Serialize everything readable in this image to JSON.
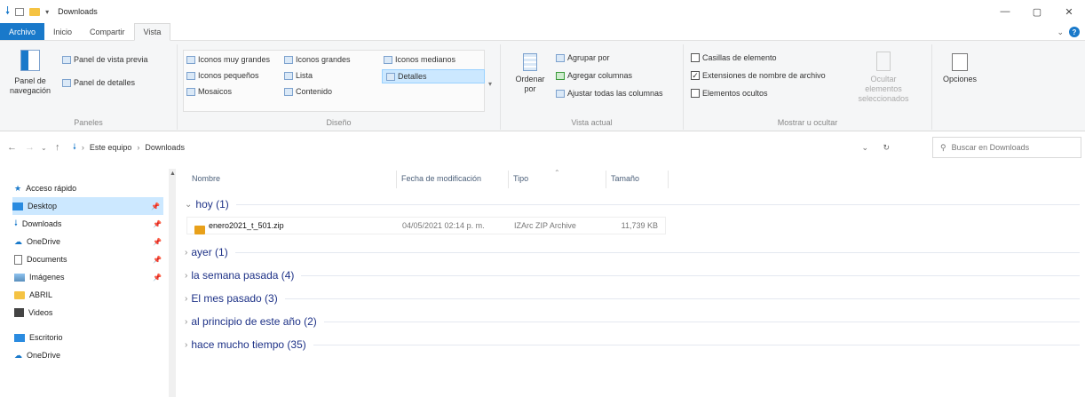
{
  "window": {
    "title": "Downloads",
    "controls": [
      "—",
      "▢",
      "✕"
    ]
  },
  "tabs": {
    "archivo": "Archivo",
    "inicio": "Inicio",
    "compartir": "Compartir",
    "vista": "Vista"
  },
  "ribbon": {
    "paneles": {
      "label": "Paneles",
      "panel_nav": "Panel de navegación",
      "panel_vista_previa": "Panel de vista previa",
      "panel_detalles": "Panel de detalles"
    },
    "diseno": {
      "label": "Diseño",
      "items": [
        "Iconos muy grandes",
        "Iconos grandes",
        "Iconos medianos",
        "Iconos pequeños",
        "Lista",
        "Detalles",
        "Mosaicos",
        "Contenido"
      ]
    },
    "vista_actual": {
      "label": "Vista actual",
      "ordenar": "Ordenar por",
      "agrupar": "Agrupar por",
      "agregar_col": "Agregar columnas",
      "ajustar": "Ajustar todas las columnas"
    },
    "mostrar": {
      "label": "Mostrar u ocultar",
      "casillas": "Casillas de elemento",
      "extensiones": "Extensiones de nombre de archivo",
      "ocultos": "Elementos ocultos",
      "ocultar_sel": "Ocultar elementos seleccionados",
      "opciones": "Opciones"
    }
  },
  "address": {
    "crumbs": [
      "Este equipo",
      "Downloads"
    ],
    "search_placeholder": "Buscar en Downloads"
  },
  "nav": {
    "items": [
      "Acceso rápido",
      "Desktop",
      "Downloads",
      "OneDrive",
      "Documents",
      "Imágenes",
      "ABRIL",
      "Videos",
      "Escritorio",
      "OneDrive"
    ]
  },
  "columns": {
    "nombre": "Nombre",
    "fecha": "Fecha de modificación",
    "tipo": "Tipo",
    "tamano": "Tamaño"
  },
  "groups": [
    "hoy (1)",
    "ayer (1)",
    "la semana pasada (4)",
    "El mes pasado (3)",
    "al principio de este año (2)",
    "hace mucho tiempo (35)"
  ],
  "file": {
    "name": "enero2021_t_501.zip",
    "date": "04/05/2021 02:14 p. m.",
    "type": "IZArc ZIP Archive",
    "size": "11,739 KB"
  },
  "colors": {
    "accent": "#1979ca",
    "selection": "#cce8ff",
    "group_text": "#1e3287"
  }
}
